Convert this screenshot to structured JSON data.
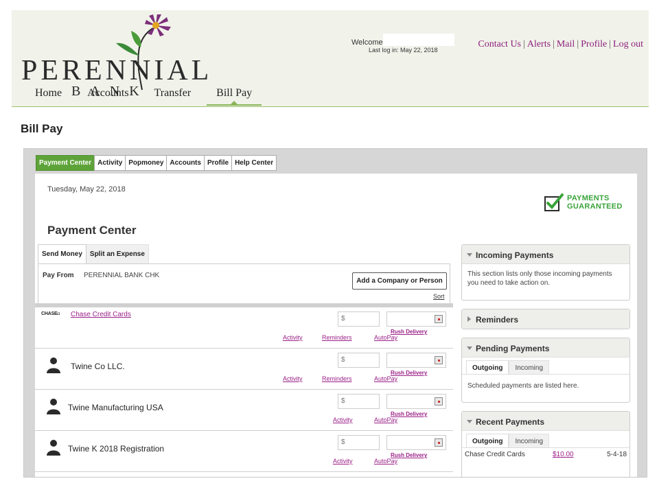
{
  "brand": {
    "name": "PERENNIAL",
    "sub": "BANK"
  },
  "header": {
    "welcome": "Welcome",
    "last_login": "Last log in: May 22, 2018",
    "links": [
      "Contact Us",
      "Alerts",
      "Mail",
      "Profile",
      "Log out"
    ],
    "separator": "|"
  },
  "nav": [
    "Home",
    "Accounts",
    "Transfer",
    "Bill Pay"
  ],
  "page_title": "Bill Pay",
  "billpay": {
    "tabs": [
      "Payment Center",
      "Activity",
      "Popmoney",
      "Accounts",
      "Profile",
      "Help Center"
    ],
    "date": "Tuesday, May 22, 2018",
    "guaranteed": {
      "line1": "PAYMENTS",
      "line2": "GUARANTEED"
    },
    "title": "Payment Center",
    "subtabs": [
      "Send Money",
      "Split an Expense"
    ],
    "pay_from_label": "Pay From",
    "pay_from_value": "PERENNIAL BANK CHK",
    "add_button": "Add a Company or Person",
    "sort": "Sort",
    "amount_placeholder": "$",
    "rush": "Rush Delivery",
    "payees": [
      {
        "name": "Chase Credit Cards",
        "logo": "CHASE",
        "links": [
          "Activity",
          "Reminders",
          "AutoPay"
        ]
      },
      {
        "name": "Twine Co LLC.",
        "links": [
          "Activity",
          "Reminders",
          "AutoPay"
        ]
      },
      {
        "name": "Twine Manufacturing USA",
        "links": [
          "Activity",
          "AutoPay"
        ]
      },
      {
        "name": "Twine K 2018 Registration",
        "links": [
          "Activity",
          "AutoPay"
        ]
      }
    ],
    "incoming": {
      "title": "Incoming Payments",
      "body": "This section lists only those incoming payments you need to take action on."
    },
    "reminders": {
      "title": "Reminders"
    },
    "pending": {
      "title": "Pending Payments",
      "tabs": [
        "Outgoing",
        "Incoming"
      ],
      "body": "Scheduled payments are listed here."
    },
    "recent": {
      "title": "Recent Payments",
      "tabs": [
        "Outgoing",
        "Incoming"
      ],
      "rows": [
        {
          "name": "Chase Credit Cards",
          "amount": "$10.00",
          "date": "5-4-18"
        }
      ]
    }
  },
  "colors": {
    "accent_green": "#5ea33a",
    "link_purple": "#9b1f87",
    "header_bg": "#f1f2ea"
  }
}
